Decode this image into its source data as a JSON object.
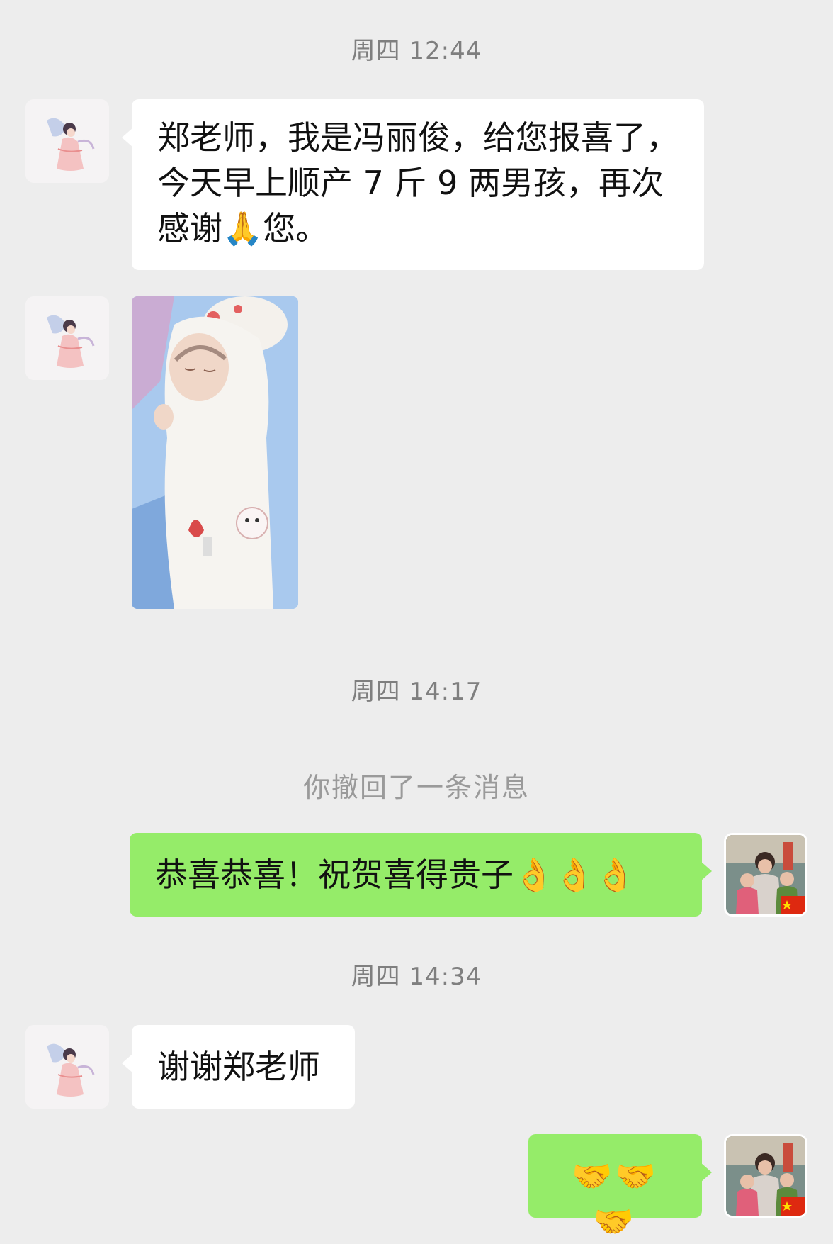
{
  "messages": [
    {
      "type": "timestamp",
      "text": "周四 12:44"
    },
    {
      "type": "incoming_text",
      "sender": "other",
      "text": "郑老师，我是冯丽俊，给您报喜了，今天早上顺产7斤9两男孩，再次感谢🙏您。",
      "lines": [
        "郑老师，我是冯丽俊，给您报喜了，",
        "今天早上顺产 7 斤 9 两男孩，再次",
        "感谢🙏您。"
      ]
    },
    {
      "type": "incoming_image",
      "sender": "other",
      "image": "newborn-baby-photo"
    },
    {
      "type": "timestamp",
      "text": "周四 14:17"
    },
    {
      "type": "system",
      "text": "你撤回了一条消息"
    },
    {
      "type": "outgoing_text",
      "sender": "me",
      "text": "恭喜恭喜！祝贺喜得贵子👌👌👌"
    },
    {
      "type": "timestamp",
      "text": "周四 14:34"
    },
    {
      "type": "incoming_text",
      "sender": "other",
      "text": "谢谢郑老师"
    },
    {
      "type": "outgoing_emoji",
      "sender": "me",
      "text": "🤝🤝🤝"
    }
  ],
  "colors": {
    "background": "#ededed",
    "incoming_bubble": "#ffffff",
    "outgoing_bubble": "#95ec69",
    "timestamp_text": "#7f7f7f"
  },
  "avatars": {
    "other": "fairy-illustration-avatar",
    "me": "family-photo-avatar-with-china-flag"
  }
}
